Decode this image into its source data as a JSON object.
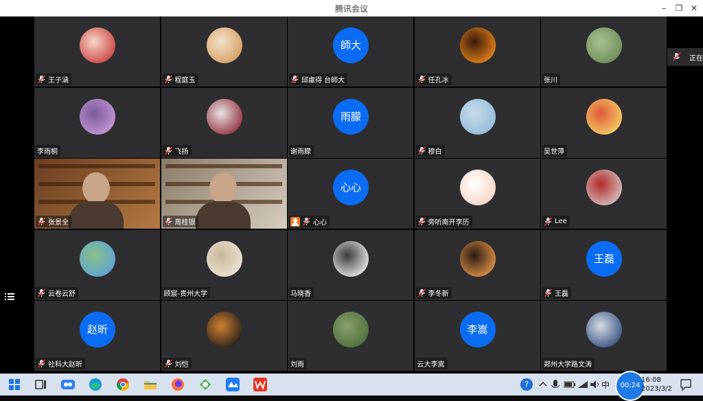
{
  "window": {
    "title": "腾讯会议"
  },
  "side_panel": {
    "text": "正在"
  },
  "participants": [
    {
      "name": "王子涵",
      "avatar_type": "image",
      "colors": [
        "#c73a3a",
        "#f5d6c8"
      ]
    },
    {
      "name": "程庭玉",
      "avatar_type": "image",
      "colors": [
        "#d49a5c",
        "#f1e2cc"
      ]
    },
    {
      "name": "邱慮得 台師大",
      "avatar_type": "text",
      "avatar_text": "師大"
    },
    {
      "name": "任孔冰",
      "avatar_type": "image",
      "colors": [
        "#f08a1c",
        "#3a1a0a"
      ]
    },
    {
      "name": "张川",
      "avatar_type": "image",
      "colors": [
        "#6b8a5a",
        "#a8c08e"
      ],
      "mic": false
    },
    {
      "name": "李雨桐",
      "avatar_type": "image",
      "colors": [
        "#c79ad8",
        "#7b5a9a"
      ],
      "mic": false
    },
    {
      "name": "飞扬",
      "avatar_type": "image",
      "colors": [
        "#8a2a3a",
        "#e8e0e0"
      ]
    },
    {
      "name": "谢雨朦",
      "avatar_type": "text",
      "avatar_text": "雨朦",
      "mic": false
    },
    {
      "name": "穆白",
      "avatar_type": "image",
      "colors": [
        "#8fb8d8",
        "#c9dcea"
      ]
    },
    {
      "name": "吴世萍",
      "avatar_type": "image",
      "colors": [
        "#f4d56a",
        "#e05a3a"
      ],
      "mic": false
    },
    {
      "name": "张景全",
      "avatar_type": "video",
      "colors": [
        "#6a3e22",
        "#b37a44"
      ],
      "video_on": true
    },
    {
      "name": "周桂银",
      "avatar_type": "video",
      "colors": [
        "#8a7a68",
        "#d6cdbf"
      ],
      "video_on": true
    },
    {
      "name": "心心",
      "avatar_type": "text",
      "avatar_text": "心心",
      "host_icon": true
    },
    {
      "name": "旁听南开李历",
      "avatar_type": "image",
      "colors": [
        "#f6d2c2",
        "#ffffff"
      ]
    },
    {
      "name": "Lee",
      "avatar_type": "image",
      "colors": [
        "#d8c8c8",
        "#b02a2a"
      ]
    },
    {
      "name": "云卷云舒",
      "avatar_type": "image",
      "colors": [
        "#5aa0d8",
        "#8ac08a"
      ]
    },
    {
      "name": "顾宸-贵州大学",
      "avatar_type": "image",
      "colors": [
        "#efe6d8",
        "#c8b89a"
      ],
      "mic": false
    },
    {
      "name": "马晓香",
      "avatar_type": "image",
      "colors": [
        "#f3f3f3",
        "#3a3a3a"
      ],
      "mic": false
    },
    {
      "name": "李冬新",
      "avatar_type": "image",
      "colors": [
        "#e89a4a",
        "#2a1a12"
      ]
    },
    {
      "name": "王磊",
      "avatar_type": "text",
      "avatar_text": "王磊"
    },
    {
      "name": "社科大赵昕",
      "avatar_type": "text",
      "avatar_text": "赵昕"
    },
    {
      "name": "刘恺",
      "avatar_type": "image",
      "colors": [
        "#1a1a1a",
        "#d08030"
      ]
    },
    {
      "name": "刘雨",
      "avatar_type": "image",
      "colors": [
        "#4a6a3a",
        "#8aa06a"
      ],
      "mic": false
    },
    {
      "name": "云大李嵩",
      "avatar_type": "text",
      "avatar_text": "李嵩",
      "mic": false
    },
    {
      "name": "郑州大学路文涛",
      "avatar_type": "image",
      "colors": [
        "#2e4a7a",
        "#d8dce6"
      ],
      "mic": false
    }
  ],
  "taskbar": {
    "apps": [
      "windows-start-icon",
      "task-view-icon",
      "tencent-meeting-icon",
      "edge-icon",
      "chrome-icon",
      "file-explorer-icon",
      "firefox-icon",
      "game-icon",
      "tencent-meeting-app-icon",
      "wps-icon"
    ],
    "clock_time": "16:08",
    "clock_date": "2023/3/2",
    "timer": "00:24",
    "lang": "中"
  }
}
